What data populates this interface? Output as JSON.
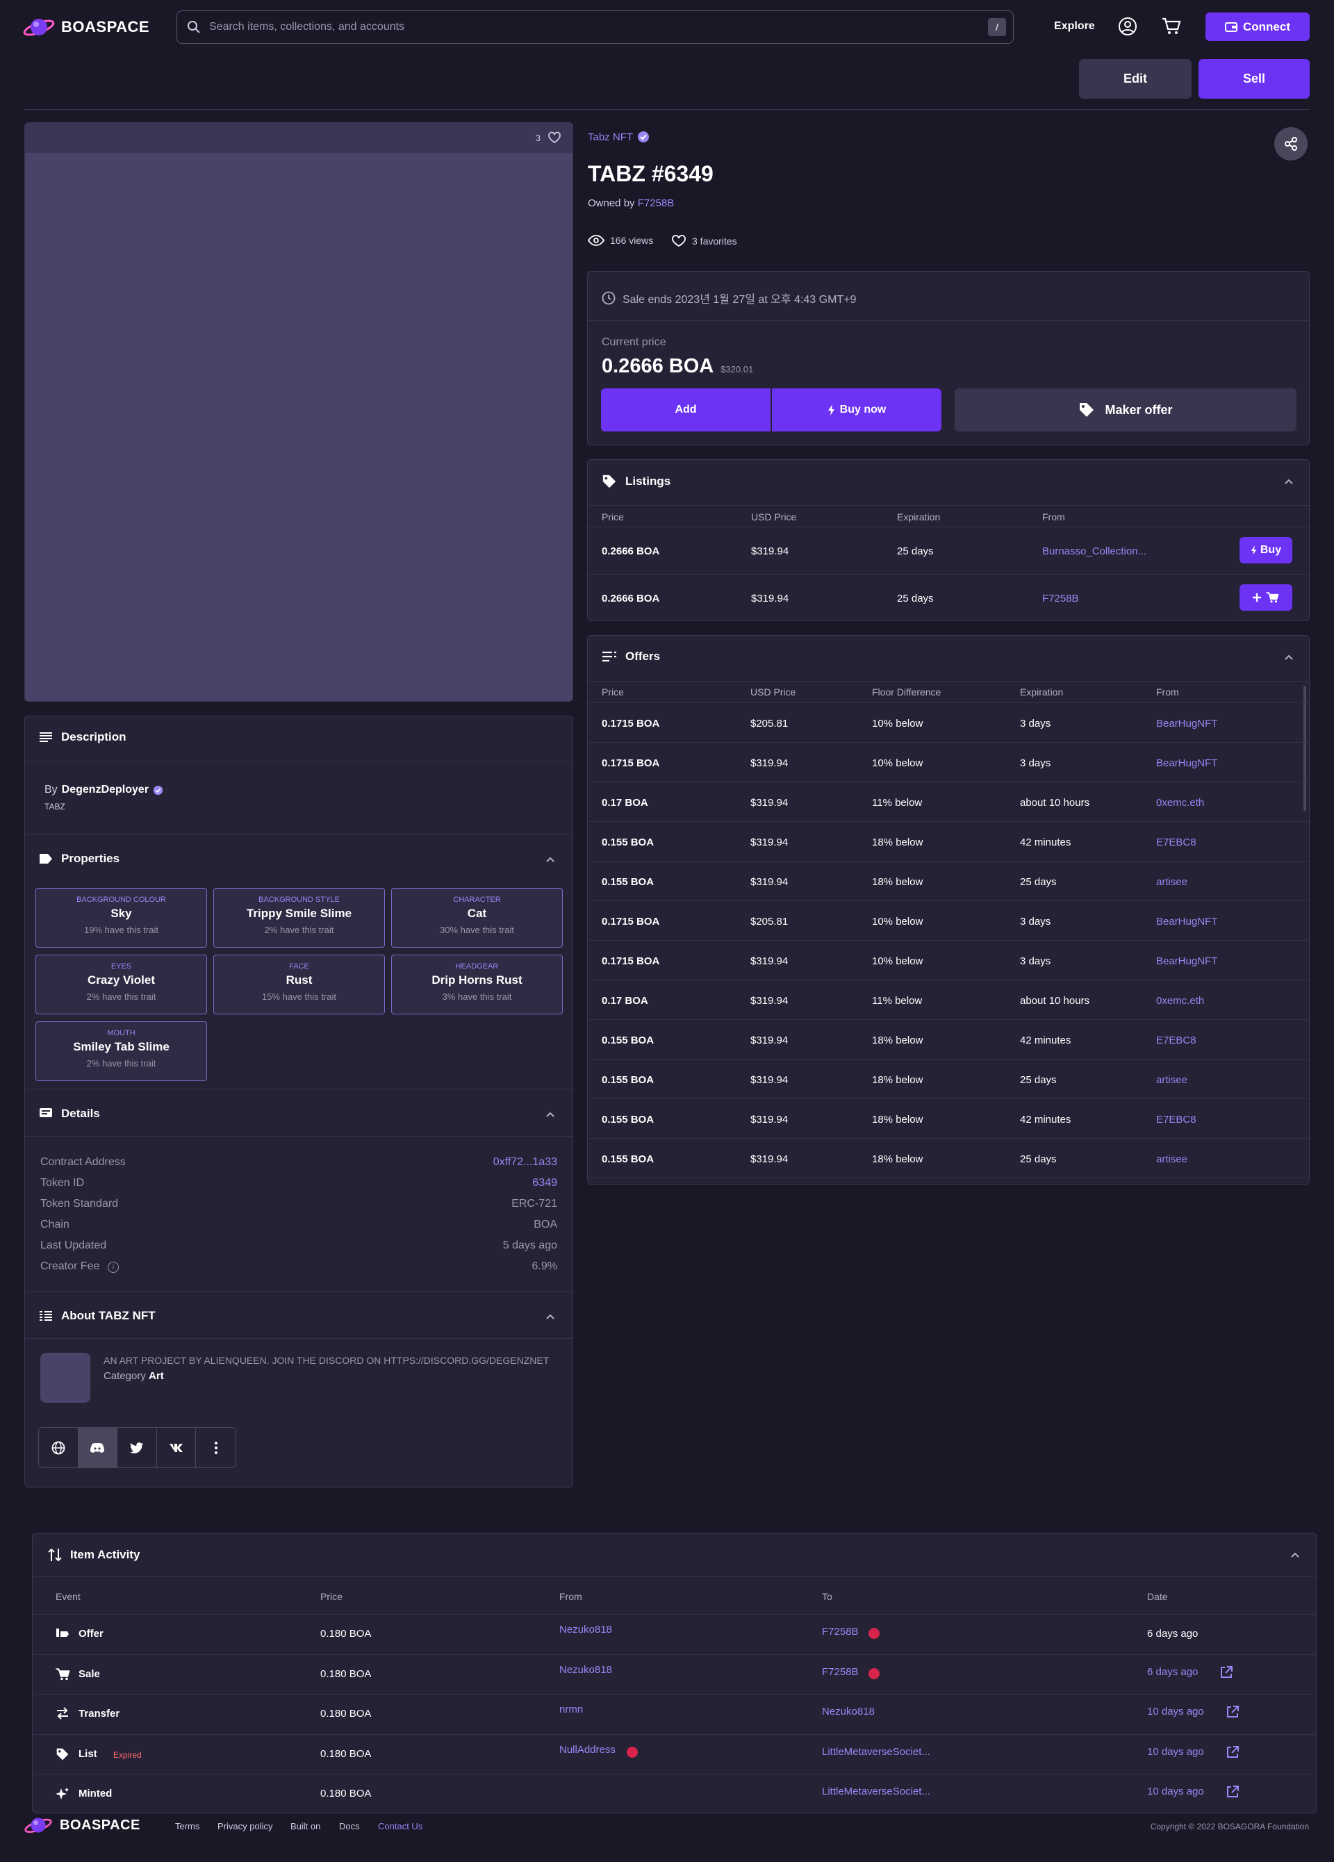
{
  "header": {
    "brand_a": "BOA",
    "brand_b": "SPACE",
    "search_placeholder": "Search items, collections, and accounts",
    "search_shortcut": "/",
    "explore": "Explore",
    "connect": "Connect"
  },
  "actions": {
    "edit": "Edit",
    "sell": "Sell"
  },
  "media": {
    "favorites_count": "3"
  },
  "item": {
    "collection": "Tabz NFT",
    "title": "TABZ #6349",
    "owned_by_label": "Owned by",
    "owner": "F7258B",
    "views": "166 views",
    "favorites": "3 favorites"
  },
  "sale": {
    "ends": "Sale ends 2023년 1월 27일 at 오후 4:43 GMT+9",
    "current_price_label": "Current price",
    "price": "0.2666 BOA",
    "usd": "$320.01",
    "add": "Add",
    "buy_now": "Buy now",
    "make_offer": "Maker offer"
  },
  "listings": {
    "title": "Listings",
    "headers": [
      "Price",
      "USD Price",
      "Expiration",
      "From"
    ],
    "rows": [
      {
        "price": "0.2666 BOA",
        "usd": "$319.94",
        "exp": "25 days",
        "from": "Burnasso_Collection...",
        "action": "Buy"
      },
      {
        "price": "0.2666 BOA",
        "usd": "$319.94",
        "exp": "25 days",
        "from": "F7258B",
        "action": ""
      }
    ]
  },
  "offers": {
    "title": "Offers",
    "headers": [
      "Price",
      "USD Price",
      "Floor Difference",
      "Expiration",
      "From"
    ],
    "rows": [
      {
        "price": "0.1715 BOA",
        "usd": "$205.81",
        "diff": "10% below",
        "exp": "3 days",
        "from": "BearHugNFT"
      },
      {
        "price": "0.1715 BOA",
        "usd": "$319.94",
        "diff": "10% below",
        "exp": "3 days",
        "from": "BearHugNFT"
      },
      {
        "price": "0.17 BOA",
        "usd": "$319.94",
        "diff": "11% below",
        "exp": "about 10 hours",
        "from": "0xemc.eth"
      },
      {
        "price": "0.155 BOA",
        "usd": "$319.94",
        "diff": "18% below",
        "exp": "42 minutes",
        "from": "E7EBC8"
      },
      {
        "price": "0.155 BOA",
        "usd": "$319.94",
        "diff": "18% below",
        "exp": "25 days",
        "from": "artisee"
      },
      {
        "price": "0.1715 BOA",
        "usd": "$205.81",
        "diff": "10% below",
        "exp": "3 days",
        "from": "BearHugNFT"
      },
      {
        "price": "0.1715 BOA",
        "usd": "$319.94",
        "diff": "10% below",
        "exp": "3 days",
        "from": "BearHugNFT"
      },
      {
        "price": "0.17 BOA",
        "usd": "$319.94",
        "diff": "11% below",
        "exp": "about 10 hours",
        "from": "0xemc.eth"
      },
      {
        "price": "0.155 BOA",
        "usd": "$319.94",
        "diff": "18% below",
        "exp": "42 minutes",
        "from": "E7EBC8"
      },
      {
        "price": "0.155 BOA",
        "usd": "$319.94",
        "diff": "18% below",
        "exp": "25 days",
        "from": "artisee"
      },
      {
        "price": "0.155 BOA",
        "usd": "$319.94",
        "diff": "18% below",
        "exp": "42 minutes",
        "from": "E7EBC8"
      },
      {
        "price": "0.155 BOA",
        "usd": "$319.94",
        "diff": "18% below",
        "exp": "25 days",
        "from": "artisee"
      }
    ]
  },
  "description": {
    "title": "Description",
    "by_label": "By",
    "creator": "DegenzDeployer",
    "collection_tag": "TABZ"
  },
  "properties": {
    "title": "Properties",
    "items": [
      {
        "type": "BACKGROUND COLOUR",
        "value": "Sky",
        "rarity": "19% have this trait"
      },
      {
        "type": "BACKGROUND STYLE",
        "value": "Trippy Smile Slime",
        "rarity": "2% have this trait"
      },
      {
        "type": "CHARACTER",
        "value": "Cat",
        "rarity": "30% have this trait"
      },
      {
        "type": "EYES",
        "value": "Crazy Violet",
        "rarity": "2% have this trait"
      },
      {
        "type": "FACE",
        "value": "Rust",
        "rarity": "15% have this trait"
      },
      {
        "type": "HEADGEAR",
        "value": "Drip Horns Rust",
        "rarity": "3% have this trait"
      },
      {
        "type": "MOUTH",
        "value": "Smiley Tab Slime",
        "rarity": "2% have this trait"
      }
    ]
  },
  "details": {
    "title": "Details",
    "rows": [
      {
        "label": "Contract Address",
        "value": "0xff72...1a33"
      },
      {
        "label": "Token ID",
        "value": "6349"
      },
      {
        "label": "Token Standard",
        "value": "ERC-721"
      },
      {
        "label": "Chain",
        "value": "BOA"
      },
      {
        "label": "Last Updated",
        "value": "5 days ago"
      },
      {
        "label": "Creator Fee",
        "value": "6.9%"
      }
    ]
  },
  "about": {
    "title": "About TABZ NFT",
    "text": "AN ART PROJECT BY ALIENQUEEN. JOIN THE DISCORD ON HTTPS://DISCORD.GG/DEGENZNET",
    "category_label": "Category",
    "category": "Art"
  },
  "activity": {
    "title": "Item Activity",
    "headers": [
      "Event",
      "Price",
      "From",
      "To",
      "Date"
    ],
    "rows": [
      {
        "event": "Offer",
        "tag": "",
        "price": "0.180 BOA",
        "from": "Nezuko818",
        "to": "F7258B",
        "date": "6 days ago"
      },
      {
        "event": "Sale",
        "tag": "",
        "price": "0.180 BOA",
        "from": "Nezuko818",
        "to": "F7258B",
        "date": "6 days ago"
      },
      {
        "event": "Transfer",
        "tag": "",
        "price": "0.180 BOA",
        "from": "nrmn",
        "to": "Nezuko818",
        "date": "10 days ago"
      },
      {
        "event": "List",
        "tag": "Expired",
        "price": "0.180 BOA",
        "from": "NullAddress",
        "to": "LittleMetaverseSociet...",
        "date": "10 days ago"
      },
      {
        "event": "Minted",
        "tag": "",
        "price": "0.180 BOA",
        "from": "",
        "to": "LittleMetaverseSociet...",
        "date": "10 days ago"
      }
    ]
  },
  "footer": {
    "brand_a": "BOA",
    "brand_b": "SPACE",
    "links": [
      "Terms",
      "Privacy policy",
      "Built on",
      "Docs",
      "Contact Us"
    ],
    "copyright": "Copyright © 2022 BOSAGORA Foundation"
  },
  "colors": {
    "accent": "#6c33f5",
    "link": "#9b86f5",
    "bg": "#1a1727",
    "panel": "#252235"
  }
}
